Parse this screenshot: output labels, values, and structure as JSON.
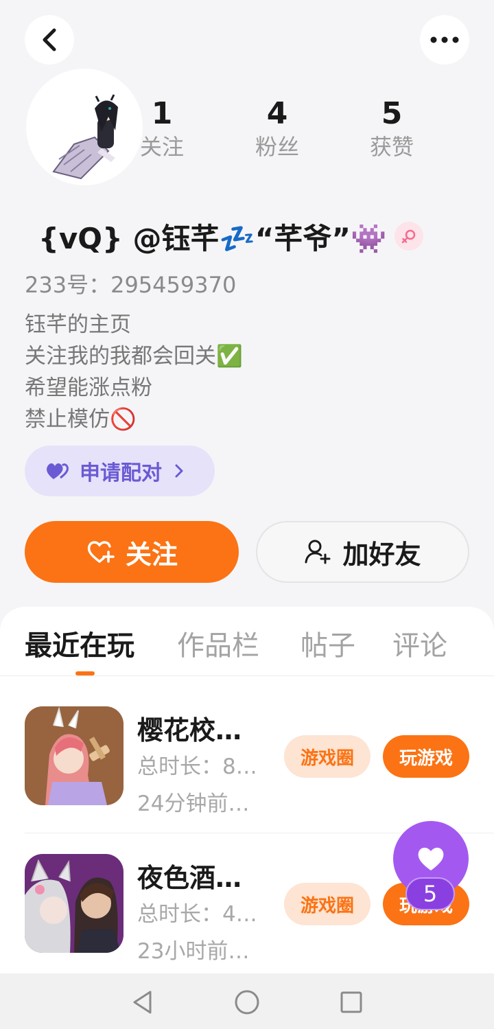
{
  "header": {
    "back_icon": "chevron-left-icon",
    "more_icon": "more-horizontal-icon"
  },
  "profile": {
    "display_name": "{vQ} @钰芊💤“芊爷”👾",
    "gender_icon": "female-icon",
    "uid": "233号：295459370",
    "bio": [
      "钰芊的主页",
      "关注我的我都会回关✅",
      "希望能涨点粉",
      "禁止模仿🚫"
    ]
  },
  "stats": [
    {
      "value": "1",
      "label": "关注"
    },
    {
      "value": "4",
      "label": "粉丝"
    },
    {
      "value": "5",
      "label": "获赞"
    }
  ],
  "match_button": {
    "label": "申请配对"
  },
  "actions": {
    "follow_label": "关注",
    "add_friend_label": "加好友"
  },
  "tabs": [
    {
      "label": "最近在玩",
      "active": true
    },
    {
      "label": "作品栏",
      "active": false
    },
    {
      "label": "帖子",
      "active": false
    },
    {
      "label": "评论",
      "active": false
    }
  ],
  "games": [
    {
      "title": "樱花校…",
      "duration": "总时长：8…",
      "last_played": "24分钟前…",
      "circle_label": "游戏圈",
      "play_label": "玩游戏"
    },
    {
      "title": "夜色酒…",
      "duration": "总时长：4…",
      "last_played": "23小时前…",
      "circle_label": "游戏圈",
      "play_label": "玩游戏"
    }
  ],
  "like_fab": {
    "count": "5"
  },
  "colors": {
    "accent": "#fb7314",
    "match_purple": "#6a5ad4",
    "fab_purple": "#a359f0"
  },
  "navbar": {
    "icons": [
      "back-triangle-icon",
      "home-circle-icon",
      "recents-square-icon"
    ]
  }
}
